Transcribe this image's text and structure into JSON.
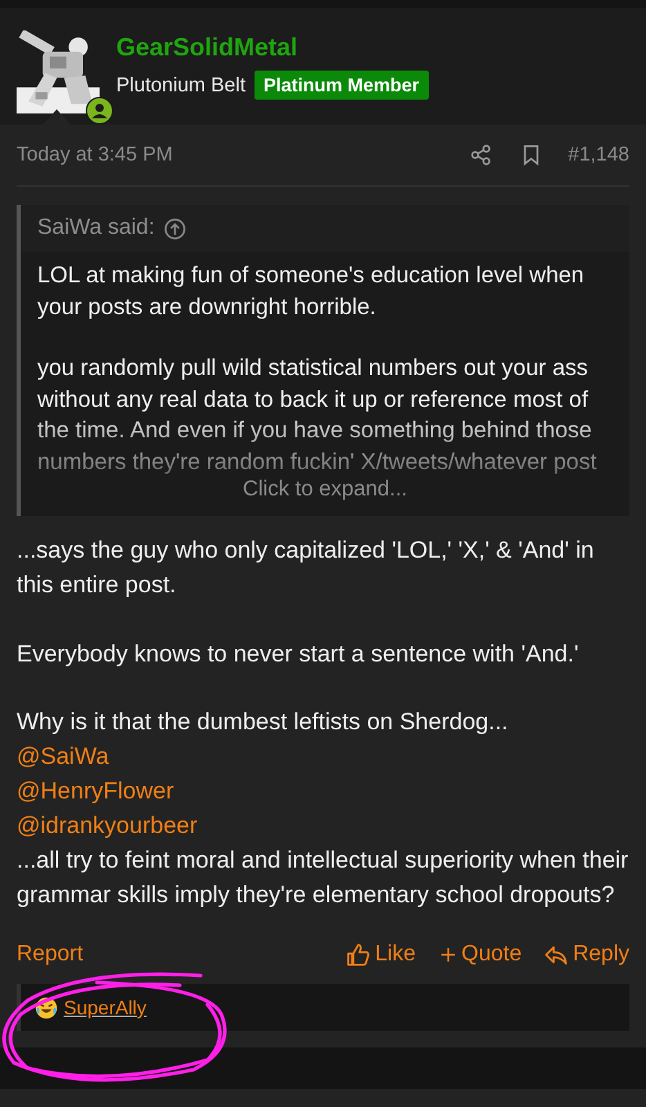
{
  "author": {
    "name": "GearSolidMetal",
    "title": "Plutonium Belt",
    "badge": "Platinum Member",
    "online": true
  },
  "meta": {
    "time": "Today at 3:45 PM",
    "post_number": "#1,148"
  },
  "quote": {
    "header": "SaiWa said:",
    "paragraphs": [
      "LOL at making fun of someone's education level when your posts are downright horrible.",
      "you randomly pull wild statistical numbers out your ass without any real data to back it up or reference most of the time. And even if you have something behind those numbers they're random fuckin' X/tweets/whatever post"
    ],
    "expand": "Click to expand..."
  },
  "body": [
    {
      "kind": "text",
      "text": "...says the guy who only capitalized 'LOL,' 'X,' & 'And' in this entire post."
    },
    {
      "kind": "gap"
    },
    {
      "kind": "text",
      "text": "Everybody knows to never start a sentence with 'And.'"
    },
    {
      "kind": "gap"
    },
    {
      "kind": "text",
      "text": "Why is it that the dumbest leftists on Sherdog..."
    },
    {
      "kind": "mention",
      "text": "@SaiWa"
    },
    {
      "kind": "mention",
      "text": "@HenryFlower"
    },
    {
      "kind": "mention",
      "text": "@idrankyourbeer"
    },
    {
      "kind": "text",
      "text": "...all try to feint moral and intellectual superiority when their grammar skills imply they're elementary school dropouts?"
    }
  ],
  "actions": {
    "report": "Report",
    "like": "Like",
    "quote": "Quote",
    "reply": "Reply"
  },
  "reactions": [
    {
      "user": "SuperAlly"
    }
  ]
}
